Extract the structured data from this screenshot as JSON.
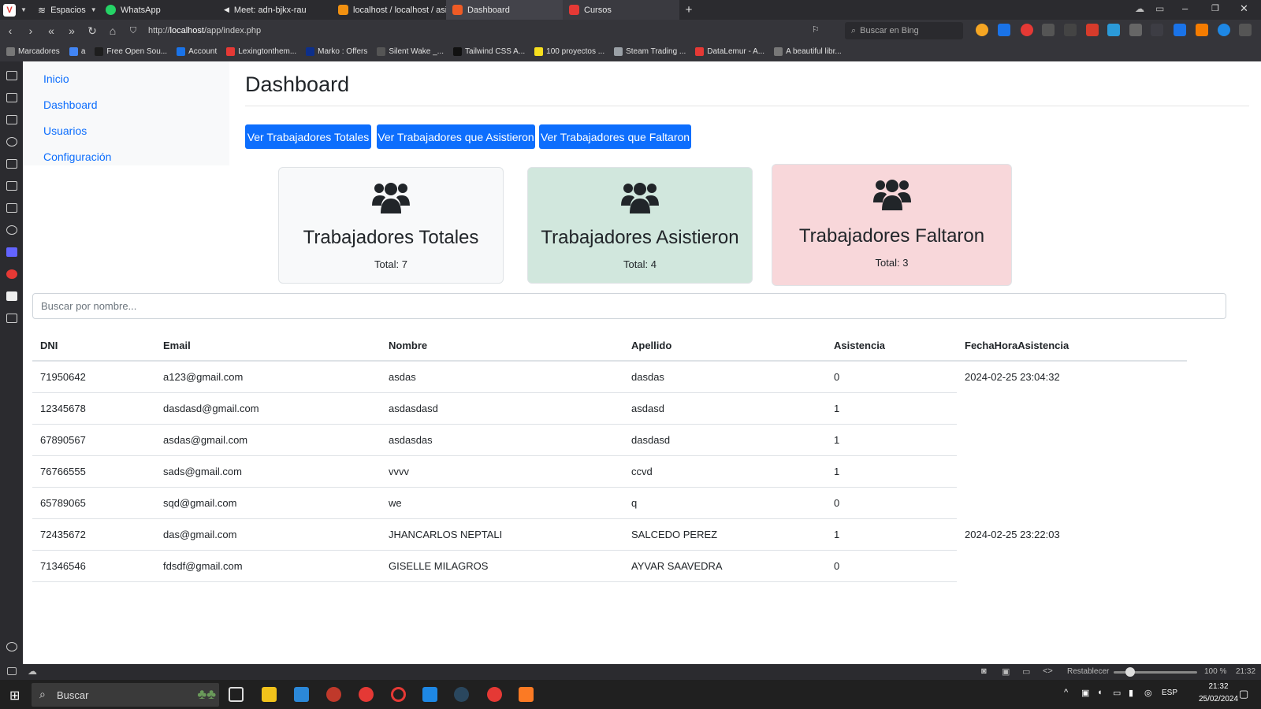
{
  "browser": {
    "tabs": [
      {
        "label": "Espacios",
        "color": "#2b2b2f"
      },
      {
        "label": "WhatsApp",
        "color": "#25d366"
      },
      {
        "label": "Meet: adn-bjkx-rau",
        "color": "#2b2b2f"
      },
      {
        "label": "localhost / localhost / asiste",
        "color": "#f29111"
      },
      {
        "label": "Dashboard",
        "color": "#ef5b25"
      },
      {
        "label": "Cursos",
        "color": "#e53935"
      }
    ],
    "url_prefix": "http://",
    "url_host": "localhost",
    "url_path": "/app/index.php",
    "search_placeholder": "Buscar en Bing",
    "bookmarks": [
      "Marcadores",
      "a",
      "Free Open Sou...",
      "Account",
      "Lexingtonthem...",
      "Marko : Offers",
      "Silent Wake _...",
      "Tailwind CSS A...",
      "100 proyectos ...",
      "Steam Trading ...",
      "DataLemur - A...",
      "A beautiful libr..."
    ],
    "bookmark_colors": [
      "#777777",
      "#4285f4",
      "#1e1e1e",
      "#1a73e8",
      "#e53935",
      "#0d2f8a",
      "#555555",
      "#111111",
      "#f7df1e",
      "#9aa0a6",
      "#e53935",
      "#777777"
    ]
  },
  "sidebar": {
    "items": [
      {
        "label": "Inicio"
      },
      {
        "label": "Dashboard"
      },
      {
        "label": "Usuarios"
      },
      {
        "label": "Configuración"
      }
    ]
  },
  "page": {
    "title": "Dashboard",
    "buttons": {
      "totales": "Ver Trabajadores Totales",
      "asistieron": "Ver Trabajadores que Asistieron",
      "faltaron": "Ver Trabajadores que Faltaron"
    },
    "cards": [
      {
        "title": "Trabajadores Totales",
        "total": "Total: 7",
        "color": "#f8f9fa"
      },
      {
        "title": "Trabajadores Asistieron",
        "total": "Total: 4",
        "color": "#d1e7dd"
      },
      {
        "title": "Trabajadores Faltaron",
        "total": "Total: 3",
        "color": "#f8d7da"
      }
    ],
    "search_placeholder": "Buscar por nombre..."
  },
  "table": {
    "headers": [
      "DNI",
      "Email",
      "Nombre",
      "Apellido",
      "Asistencia",
      "FechaHoraAsistencia"
    ],
    "rows": [
      [
        "71950642",
        "a123@gmail.com",
        "asdas",
        "dasdas",
        "0",
        "2024-02-25 23:04:32"
      ],
      [
        "12345678",
        "dasdasd@gmail.com",
        "asdasdasd",
        "asdasd",
        "1",
        ""
      ],
      [
        "67890567",
        "asdas@gmail.com",
        "asdasdas",
        "dasdasd",
        "1",
        ""
      ],
      [
        "76766555",
        "sads@gmail.com",
        "vvvv",
        "ccvd",
        "1",
        ""
      ],
      [
        "65789065",
        "sqd@gmail.com",
        "we",
        "q",
        "0",
        ""
      ],
      [
        "72435672",
        "das@gmail.com",
        "JHANCARLOS NEPTALI",
        "SALCEDO PEREZ",
        "1",
        "2024-02-25 23:22:03"
      ],
      [
        "71346546",
        "fdsdf@gmail.com",
        "GISELLE MILAGROS",
        "AYVAR SAAVEDRA",
        "0",
        ""
      ]
    ]
  },
  "statusbar": {
    "reset": "Restablecer",
    "zoom": "100 %",
    "time": "21:32"
  },
  "taskbar": {
    "search": "Buscar",
    "lang": "ESP",
    "time": "21:32",
    "date": "25/02/2024"
  },
  "colors": {
    "primary": "#0d6efd",
    "link": "#0d6efd",
    "icon": "#212529"
  }
}
